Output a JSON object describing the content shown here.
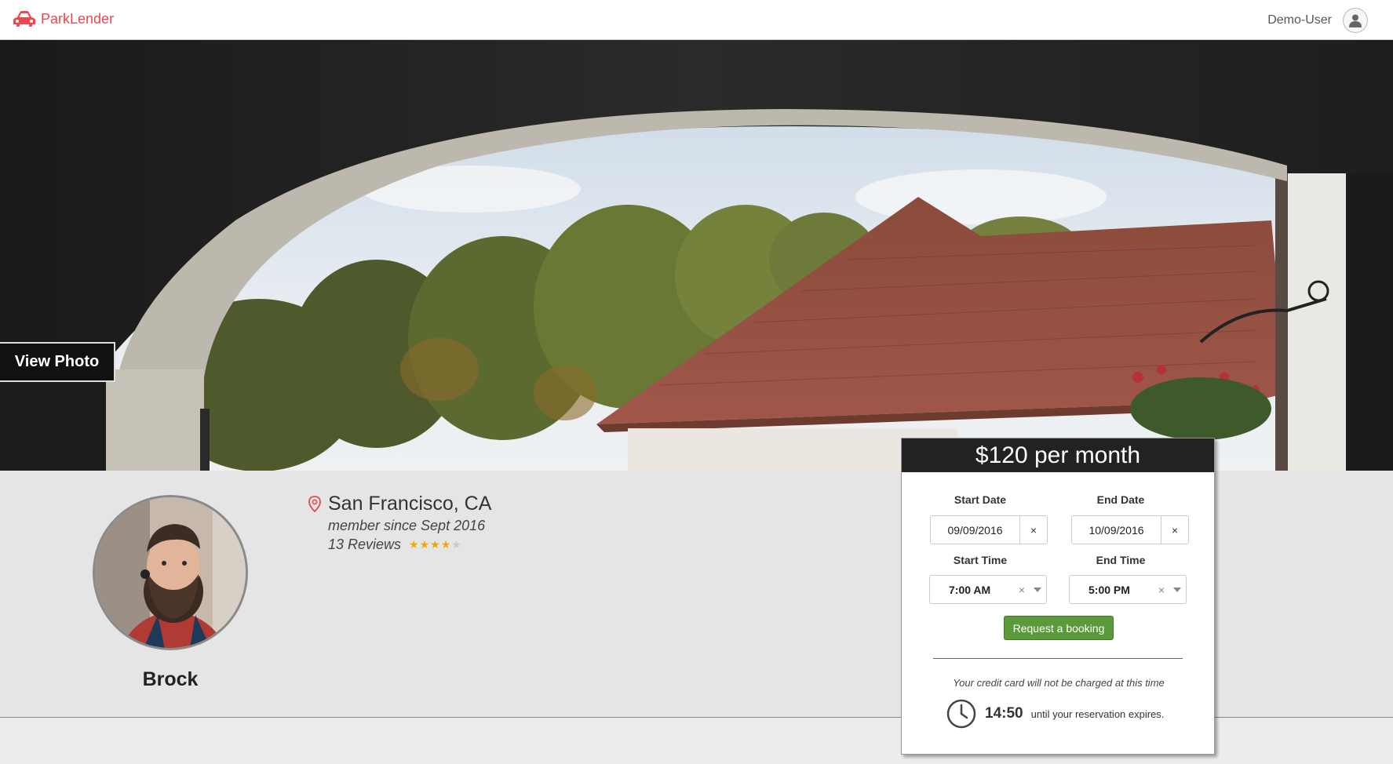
{
  "navbar": {
    "brand_name": "ParkLender",
    "brand_icon": "car-icon",
    "user_name": "Demo-User",
    "user_icon": "user-avatar-icon"
  },
  "hero": {
    "view_photo_label": "View Photo"
  },
  "host": {
    "name": "Brock",
    "location": "San Francisco, CA",
    "member_since": "member since Sept 2016",
    "reviews_label": "13 Reviews",
    "rating": 4,
    "rating_max": 5
  },
  "booking": {
    "price": "$120 per month",
    "start_date_label": "Start Date",
    "start_date_value": "09/09/2016",
    "end_date_label": "End Date",
    "end_date_value": "10/09/2016",
    "start_time_label": "Start Time",
    "start_time_value": "7:00 AM",
    "end_time_label": "End Time",
    "end_time_value": "5:00 PM",
    "clear_symbol": "×",
    "request_button": "Request a booking",
    "charge_note": "Your credit card will not be charged at this time",
    "timer_value": "14:50",
    "timer_text": "until your reservation expires."
  },
  "colors": {
    "brand": "#e8484e",
    "button": "#5a9a3b",
    "star": "#f0a800",
    "price_bar": "#222222"
  }
}
